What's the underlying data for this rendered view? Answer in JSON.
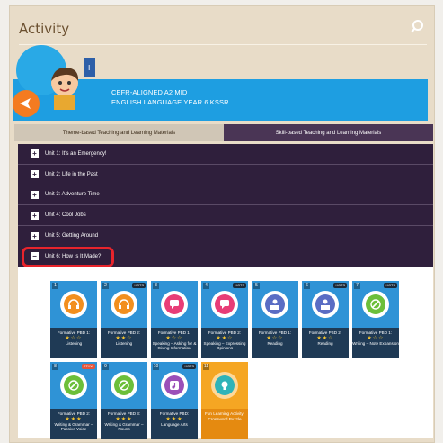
{
  "header": {
    "title": "Activity"
  },
  "banner": {
    "line1": "CEFR-ALIGNED A2 MID",
    "line2": "ENGLISH LANGUAGE YEAR 6 KSSR"
  },
  "tabs": [
    {
      "label": "Theme-based Teaching and Learning Materials"
    },
    {
      "label": "Skill-based Teaching and Learning Materials"
    }
  ],
  "units": [
    {
      "label": "Unit 1: It's an Emergency!"
    },
    {
      "label": "Unit 2: Life in the Past"
    },
    {
      "label": "Unit 3: Adventure Time"
    },
    {
      "label": "Unit 4: Cool Jobs"
    },
    {
      "label": "Unit 5: Getting Around"
    },
    {
      "label": "Unit 6: How Is It Made?"
    }
  ],
  "cards": [
    {
      "num": "1",
      "badge": "",
      "title": "Formative PBD 1:",
      "stars": "★☆☆",
      "skill": "Listening",
      "color": "#f28f1e"
    },
    {
      "num": "2",
      "badge": "HOTS",
      "title": "Formative PBD 2:",
      "stars": "★★☆",
      "skill": "Listening",
      "color": "#f28f1e"
    },
    {
      "num": "3",
      "badge": "",
      "title": "Formative PBD 1:",
      "stars": "★☆☆",
      "skill": "Speaking – Asking for & Giving Information",
      "color": "#e83d77"
    },
    {
      "num": "4",
      "badge": "HOTS",
      "title": "Formative PBD 2:",
      "stars": "★★☆",
      "skill": "Speaking – Expressing Opinions",
      "color": "#e83d77"
    },
    {
      "num": "5",
      "badge": "",
      "title": "Formative PBD 1:",
      "stars": "★☆☆",
      "skill": "Reading",
      "color": "#5a6dc4"
    },
    {
      "num": "6",
      "badge": "HOTS",
      "title": "Formative PBD 2:",
      "stars": "★★☆",
      "skill": "Reading",
      "color": "#5a6dc4"
    },
    {
      "num": "7",
      "badge": "HOTS",
      "title": "Formative PBD 1:",
      "stars": "★☆☆",
      "skill": "Writing – Note Expansion",
      "color": "#6cbf3a"
    },
    {
      "num": "8",
      "badge": "CTHW",
      "title": "Formative PBD 2:",
      "stars": "★★★",
      "skill": "Writing & Grammar – Passive Voice",
      "color": "#6cbf3a"
    },
    {
      "num": "9",
      "badge": "",
      "title": "Formative PBD 3:",
      "stars": "★★★",
      "skill": "Writing & Grammar – Nouns",
      "color": "#6cbf3a"
    },
    {
      "num": "10",
      "badge": "HOTS",
      "title": "Formative PBD:",
      "stars": "★★★",
      "skill": "Language Arts",
      "color": "#9b4fb8"
    },
    {
      "num": "11",
      "badge": "",
      "title": "Fun Learning Activity:",
      "stars": "",
      "skill": "Crossword Puzzle",
      "color": "#f5a623"
    }
  ],
  "colors": {
    "banner": "#1e9ee1",
    "units_bg": "#2f1f3c",
    "highlight": "#e8242c"
  }
}
